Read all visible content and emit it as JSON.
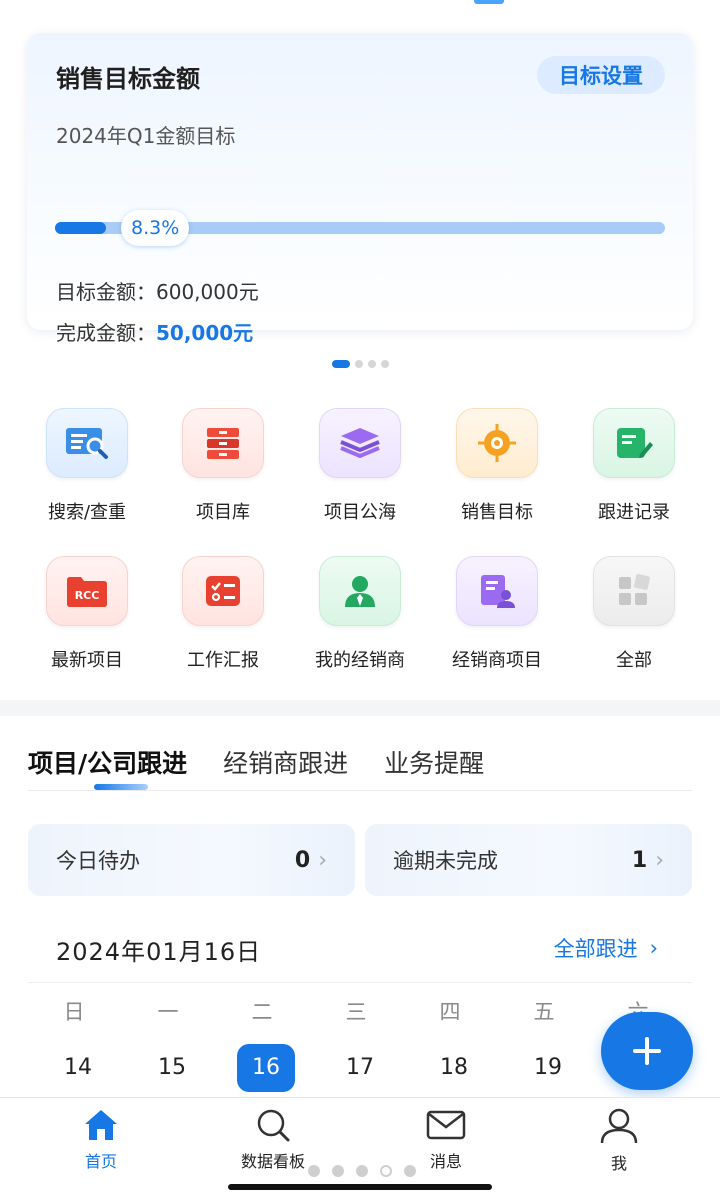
{
  "target_card": {
    "title": "销售目标金额",
    "setting_button": "目标设置",
    "subtitle": "2024年Q1金额目标",
    "progress_label": "8.3%",
    "progress_fraction": 0.083,
    "target_label": "目标金额：",
    "target_value": "600,000元",
    "done_label": "完成金额：",
    "done_value": "50,000元"
  },
  "grid": {
    "items": [
      {
        "label": "搜索/查重",
        "icon": "search-report-icon"
      },
      {
        "label": "项目库",
        "icon": "drawer-cabinet-icon"
      },
      {
        "label": "项目公海",
        "icon": "layers-icon"
      },
      {
        "label": "销售目标",
        "icon": "target-icon"
      },
      {
        "label": "跟进记录",
        "icon": "note-edit-icon"
      },
      {
        "label": "最新项目",
        "icon": "rcc-folder-icon"
      },
      {
        "label": "工作汇报",
        "icon": "checklist-icon"
      },
      {
        "label": "我的经销商",
        "icon": "dealer-person-icon"
      },
      {
        "label": "经销商项目",
        "icon": "dealer-doc-icon"
      },
      {
        "label": "全部",
        "icon": "all-apps-icon"
      }
    ]
  },
  "tabs": [
    "项目/公司跟进",
    "经销商跟进",
    "业务提醒"
  ],
  "stats": {
    "today": {
      "label": "今日待办",
      "value": "0"
    },
    "overdue": {
      "label": "逾期未完成",
      "value": "1"
    }
  },
  "date_header": {
    "date": "2024年01月16日",
    "all_follow": "全部跟进",
    "chevron": "›"
  },
  "calendar": {
    "weekdays": [
      "日",
      "一",
      "二",
      "三",
      "四",
      "五",
      "六"
    ],
    "days": [
      "14",
      "15",
      "16",
      "17",
      "18",
      "19"
    ],
    "selected_day": "16"
  },
  "bottom_nav": [
    {
      "label": "首页",
      "icon": "home-icon"
    },
    {
      "label": "数据看板",
      "icon": "search-icon"
    },
    {
      "label": "消息",
      "icon": "mail-icon"
    },
    {
      "label": "我",
      "icon": "user-icon"
    }
  ],
  "colors": {
    "accent": "#1677e5",
    "accent_light": "#dcebff"
  }
}
